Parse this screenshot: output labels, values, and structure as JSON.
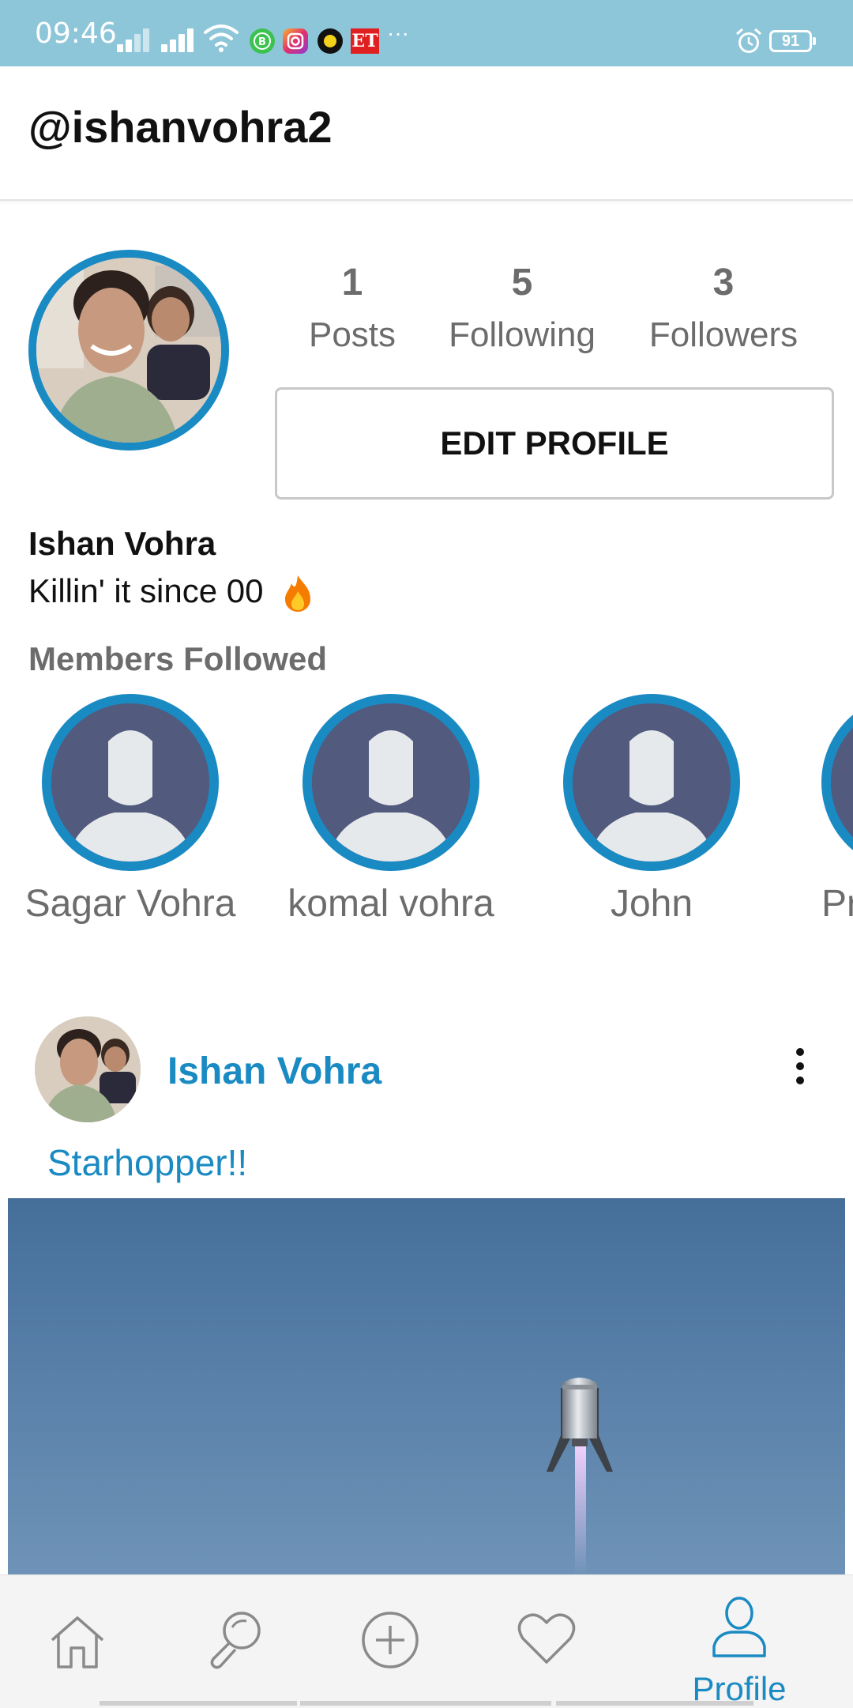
{
  "status_bar": {
    "time": "09:46",
    "battery": "91",
    "more": "···",
    "et_badge": "ET"
  },
  "header": {
    "username": "@ishanvohra2"
  },
  "profile": {
    "stats": [
      {
        "value": "1",
        "label": "Posts"
      },
      {
        "value": "5",
        "label": "Following"
      },
      {
        "value": "3",
        "label": "Followers"
      }
    ],
    "edit_label": "EDIT PROFILE",
    "name": "Ishan Vohra",
    "bio": "Killin' it since 00"
  },
  "members": {
    "title": "Members Followed",
    "items": [
      {
        "name": "Sagar Vohra"
      },
      {
        "name": "komal vohra"
      },
      {
        "name": "John"
      },
      {
        "name": "Pr"
      }
    ]
  },
  "post": {
    "author": "Ishan Vohra",
    "caption": "Starhopper!!"
  },
  "nav": {
    "items": [
      {
        "icon": "home-icon"
      },
      {
        "icon": "search-icon"
      },
      {
        "icon": "add-icon"
      },
      {
        "icon": "heart-icon"
      },
      {
        "icon": "profile-icon",
        "label": "Profile"
      }
    ]
  },
  "colors": {
    "accent": "#1a8ac3",
    "status_bar": "#8ec6d9",
    "text_muted": "#6c6c6c",
    "avatar_placeholder": "#525a7e"
  }
}
